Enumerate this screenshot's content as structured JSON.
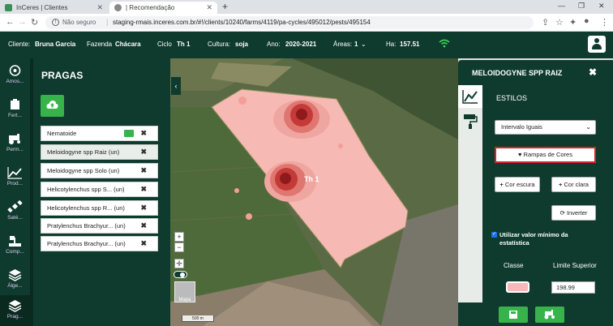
{
  "browser": {
    "tabs": [
      {
        "title": "InCeres | Clientes"
      },
      {
        "title": "| Recomendação"
      }
    ],
    "address": {
      "security_label": "Não seguro",
      "url": "staging-rmais.inceres.com.br/#!/clients/10240/farms/4119/pa-cycles/495012/pests/495154"
    }
  },
  "header": {
    "cliente_label": "Cliente:",
    "cliente_value": "Bruna Garcia",
    "fazenda_label": "Fazenda",
    "fazenda_value": "Chácara",
    "ciclo_label": "Ciclo",
    "ciclo_value": "Th 1",
    "cultura_label": "Cultura:",
    "cultura_value": "soja",
    "ano_label": "Ano:",
    "ano_value": "2020-2021",
    "areas_label": "Áreas:",
    "areas_value": "1",
    "ha_label": "Ha:",
    "ha_value": "157.51"
  },
  "leftnav": {
    "items": [
      {
        "label": "Amos...",
        "icon": "sampling-icon"
      },
      {
        "label": "Fert...",
        "icon": "fertility-icon"
      },
      {
        "label": "Perm...",
        "icon": "tractor-icon"
      },
      {
        "label": "Prod...",
        "icon": "chart-icon"
      },
      {
        "label": "Saté...",
        "icon": "satellite-icon"
      },
      {
        "label": "Comp...",
        "icon": "compaction-icon"
      },
      {
        "label": "Álge...",
        "icon": "layers-icon"
      },
      {
        "label": "Prag...",
        "icon": "layers-icon"
      }
    ]
  },
  "pragas": {
    "title": "PRAGAS",
    "items": [
      {
        "label": "Nematoide"
      },
      {
        "label": "Meloidogyne spp Raiz (un)"
      },
      {
        "label": "Meloidogyne spp Solo (un)"
      },
      {
        "label": "Helicotylenchus spp S... (un)"
      },
      {
        "label": "Helicotylenchus spp R... (un)"
      },
      {
        "label": "Pratylenchus Brachyur... (un)"
      },
      {
        "label": "Pratylenchus Brachyur... (un)"
      }
    ]
  },
  "map": {
    "field_label": "Th 1",
    "zoom_in": "+",
    "zoom_out": "−",
    "scale_label": "500 m",
    "maptype_label": "Mapa"
  },
  "style_panel": {
    "title": "MELOIDOGYNE SPP RAIZ",
    "section": "ESTILOS",
    "select_value": "Intervalo Iguais",
    "rampas_label": "♥ Rampas de Cores",
    "cor_escura_label": "Cor escura",
    "cor_clara_label": "Cor clara",
    "inverter_label": "Inverter",
    "checkbox_label": "Utilizar valor mínimo da estatística",
    "col_classe": "Classe",
    "col_limite": "Limite Superior",
    "limite_value": "198.99",
    "colors": {
      "accent": "#38b24a",
      "dark": "#0f3b2e",
      "highlight": "#d8232a",
      "class1": "#f6b9b9"
    }
  }
}
